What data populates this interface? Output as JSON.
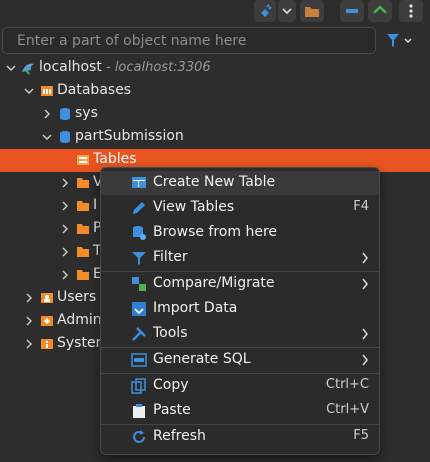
{
  "search": {
    "placeholder": "Enter a part of object name here"
  },
  "tree": {
    "connection": {
      "label": "localhost",
      "detail": "- localhost:3306"
    },
    "databases": "Databases",
    "sys": "sys",
    "db": "partSubmission",
    "tables": "Tables",
    "truncated": [
      "V",
      "I",
      "P",
      "T",
      "E"
    ],
    "users": "Users",
    "admin": "Admin",
    "system": "System"
  },
  "menu": {
    "items": [
      {
        "label": "Create New Table",
        "shortcut": ""
      },
      {
        "label": "View Tables",
        "shortcut": "F4"
      },
      {
        "label": "Browse from here",
        "shortcut": ""
      },
      {
        "label": "Filter",
        "shortcut": ""
      },
      {
        "label": "Compare/Migrate",
        "shortcut": ""
      },
      {
        "label": "Import Data",
        "shortcut": ""
      },
      {
        "label": "Tools",
        "shortcut": ""
      },
      {
        "label": "Generate SQL",
        "shortcut": ""
      },
      {
        "label": "Copy",
        "shortcut": "Ctrl+C"
      },
      {
        "label": "Paste",
        "shortcut": "Ctrl+V"
      },
      {
        "label": "Refresh",
        "shortcut": "F5"
      }
    ]
  },
  "colors": {
    "selection": "#e95420",
    "folder": "#f28c28",
    "db": "#3d8fe0"
  }
}
